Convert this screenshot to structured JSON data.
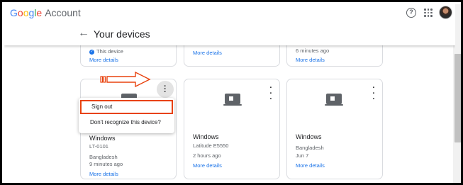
{
  "header": {
    "logo_google": [
      "G",
      "o",
      "o",
      "g",
      "l",
      "e"
    ],
    "logo_account": "Account",
    "help_icon": "help-circle-icon",
    "apps_icon": "apps-grid-icon",
    "avatar_icon": "user-avatar"
  },
  "page": {
    "title": "Your devices",
    "back_icon": "arrow-back-icon"
  },
  "top_cards": [
    {
      "sub": "This device",
      "link": "More details"
    },
    {
      "sub": "",
      "link": "More details"
    },
    {
      "sub": "6 minutes ago",
      "link": "More details"
    }
  ],
  "cards": [
    {
      "name": "Windows",
      "model": "LT-0101",
      "location": "Bangladesh",
      "time": "9 minutes ago",
      "link": "More details"
    },
    {
      "name": "Windows",
      "model": "Latitude E5550",
      "location": "",
      "time": "2 hours ago",
      "link": "More details"
    },
    {
      "name": "Windows",
      "model": "",
      "location": "Bangladesh",
      "time": "Jun 7",
      "link": "More details"
    }
  ],
  "menu": {
    "sign_out": "Sign out",
    "dont_recognize": "Don't recognize this device?"
  },
  "colors": {
    "accent": "#1a73e8",
    "highlight": "#e8420e",
    "card_border": "#dadce0"
  }
}
